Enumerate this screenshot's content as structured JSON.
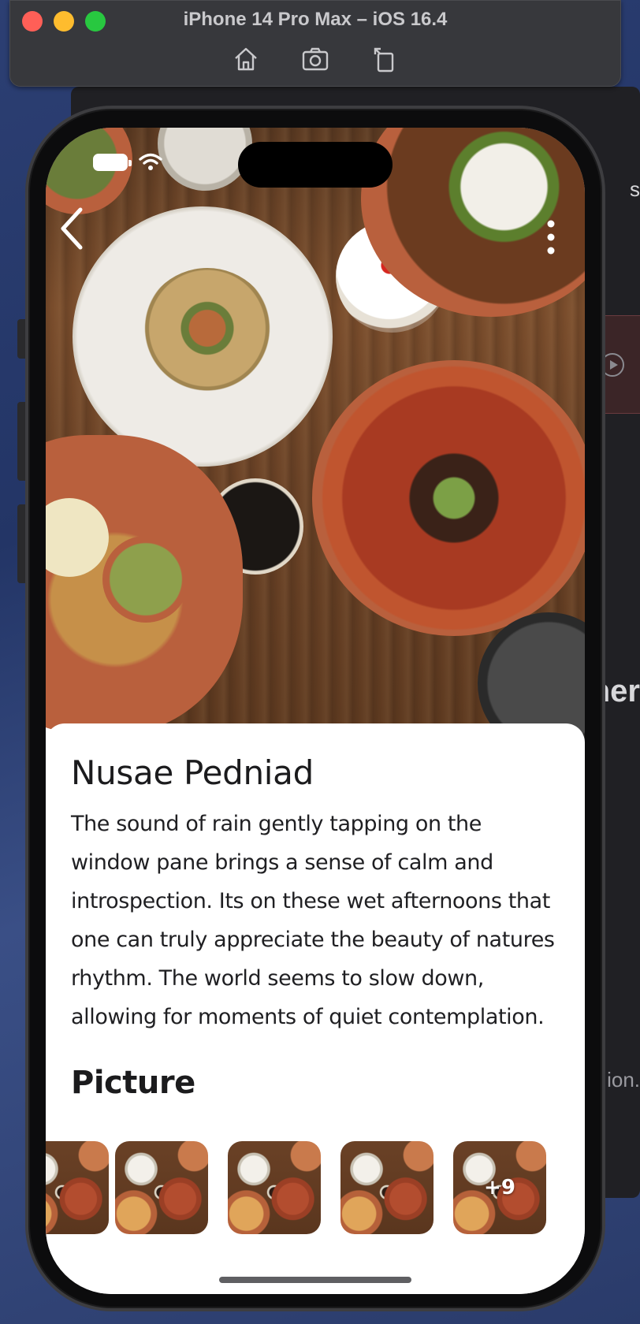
{
  "simulator": {
    "title": "iPhone 14 Pro Max – iOS 16.4",
    "tools": [
      {
        "icon": "home-icon"
      },
      {
        "icon": "screenshot-icon"
      },
      {
        "icon": "rotate-icon"
      }
    ]
  },
  "background_window": {
    "partial_text_top": "s",
    "partial_text_mid": "her",
    "partial_text_bottom": "ion."
  },
  "status_bar": {
    "battery_icon": "battery-icon",
    "wifi_icon": "wifi-icon"
  },
  "navigation": {
    "back_icon": "chevron-left-icon",
    "menu_icon": "more-vertical-icon"
  },
  "detail": {
    "title": "Nusae Pedniad",
    "description": "The sound of rain gently tapping on the window pane brings a sense of calm and introspection. Its on these wet afternoons that one can truly appreciate the beauty of natures rhythm. The world seems to slow down, allowing for moments of quiet contemplation.",
    "pictures_heading": "Picture",
    "more_count": "+9"
  },
  "colors": {
    "sheet_bg": "#ffffff",
    "text_primary": "#1b1b1d",
    "sim_bar": "#37383c"
  }
}
